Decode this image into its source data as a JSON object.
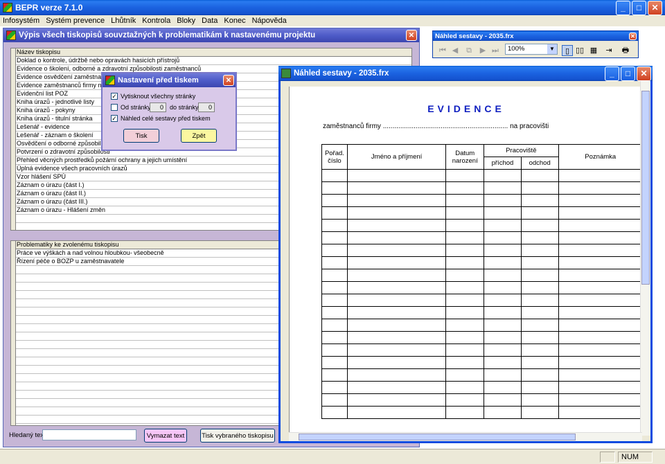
{
  "app": {
    "title": "BEPR verze 7.1.0"
  },
  "menu": [
    "Infosystém",
    "Systém prevence",
    "Lhůtník",
    "Kontrola",
    "Bloky",
    "Data",
    "Konec",
    "Nápověda"
  ],
  "list_window": {
    "title": "Výpis všech tiskopisů souvztažných k problematikám k nastavenému projektu",
    "grid1_header": "Název tiskopisu",
    "grid1_rows": [
      "Doklad o kontrole, údržbě nebo opravách hasicích přístrojů",
      "Evidence o školení, odborné a zdravotní způsobilosti zaměstnanců",
      "Evidence osvědčení zaměstnanců",
      "Evidence zaměstnanců firmy na pracovišti",
      "Evidenční list POZ",
      "Kniha úrazů - jednotlivé listy",
      "Kniha úrazů - pokyny",
      "Kniha úrazů - titulní stránka",
      "Lešenář - evidence",
      "Lešenář - záznam o školení",
      "Osvědčení o odborné způsobilosti",
      "Potvrzení o zdravotní způsobilosti",
      "Přehled věcných prostředků požární ochrany a jejich umístění",
      "Úplná evidence všech pracovních úrazů",
      "Vzor hlášení SPÚ",
      "Záznam o úrazu (část I.)",
      "Záznam o úrazu (část II.)",
      "Záznam o úrazu (část III.)",
      "Záznam o úrazu - Hlášení změn"
    ],
    "grid2_header": "Problematiky ke zvolenému tiskopisu",
    "grid2_rows": [
      "Práce ve výškách a nad volnou hloubkou- všeobecně",
      "Řízení péče o BOZP u zaměstnavatele"
    ],
    "search_label": "Hledaný text",
    "search_value": "",
    "clear_button": "Vymazat text",
    "print_button": "Tisk vybraného tiskopisu"
  },
  "dialog": {
    "title": "Nastavení před tiskem",
    "print_all": "Vytisknout všechny stránky",
    "from_label": "Od stránky",
    "from_value": "0",
    "to_label": "do stránky",
    "to_value": "0",
    "preview_label": "Náhled celé sestavy před tiskem",
    "print_btn": "Tisk",
    "back_btn": "Zpět"
  },
  "preview_toolbar": {
    "title": "Náhled sestavy - 2035.frx",
    "zoom": "100%"
  },
  "preview": {
    "title": "Náhled sestavy - 2035.frx",
    "doc_title": "EVIDENCE",
    "doc_line": "zaměstnanců firmy ................................................................. na pracovišti",
    "col_order": "Pořad. číslo",
    "col_name": "Jméno a příjmení",
    "col_birth": "Datum narození",
    "col_workplace": "Pracoviště",
    "col_arrival": "příchod",
    "col_departure": "odchod",
    "col_note": "Poznámka"
  },
  "status": {
    "num": "NUM"
  }
}
